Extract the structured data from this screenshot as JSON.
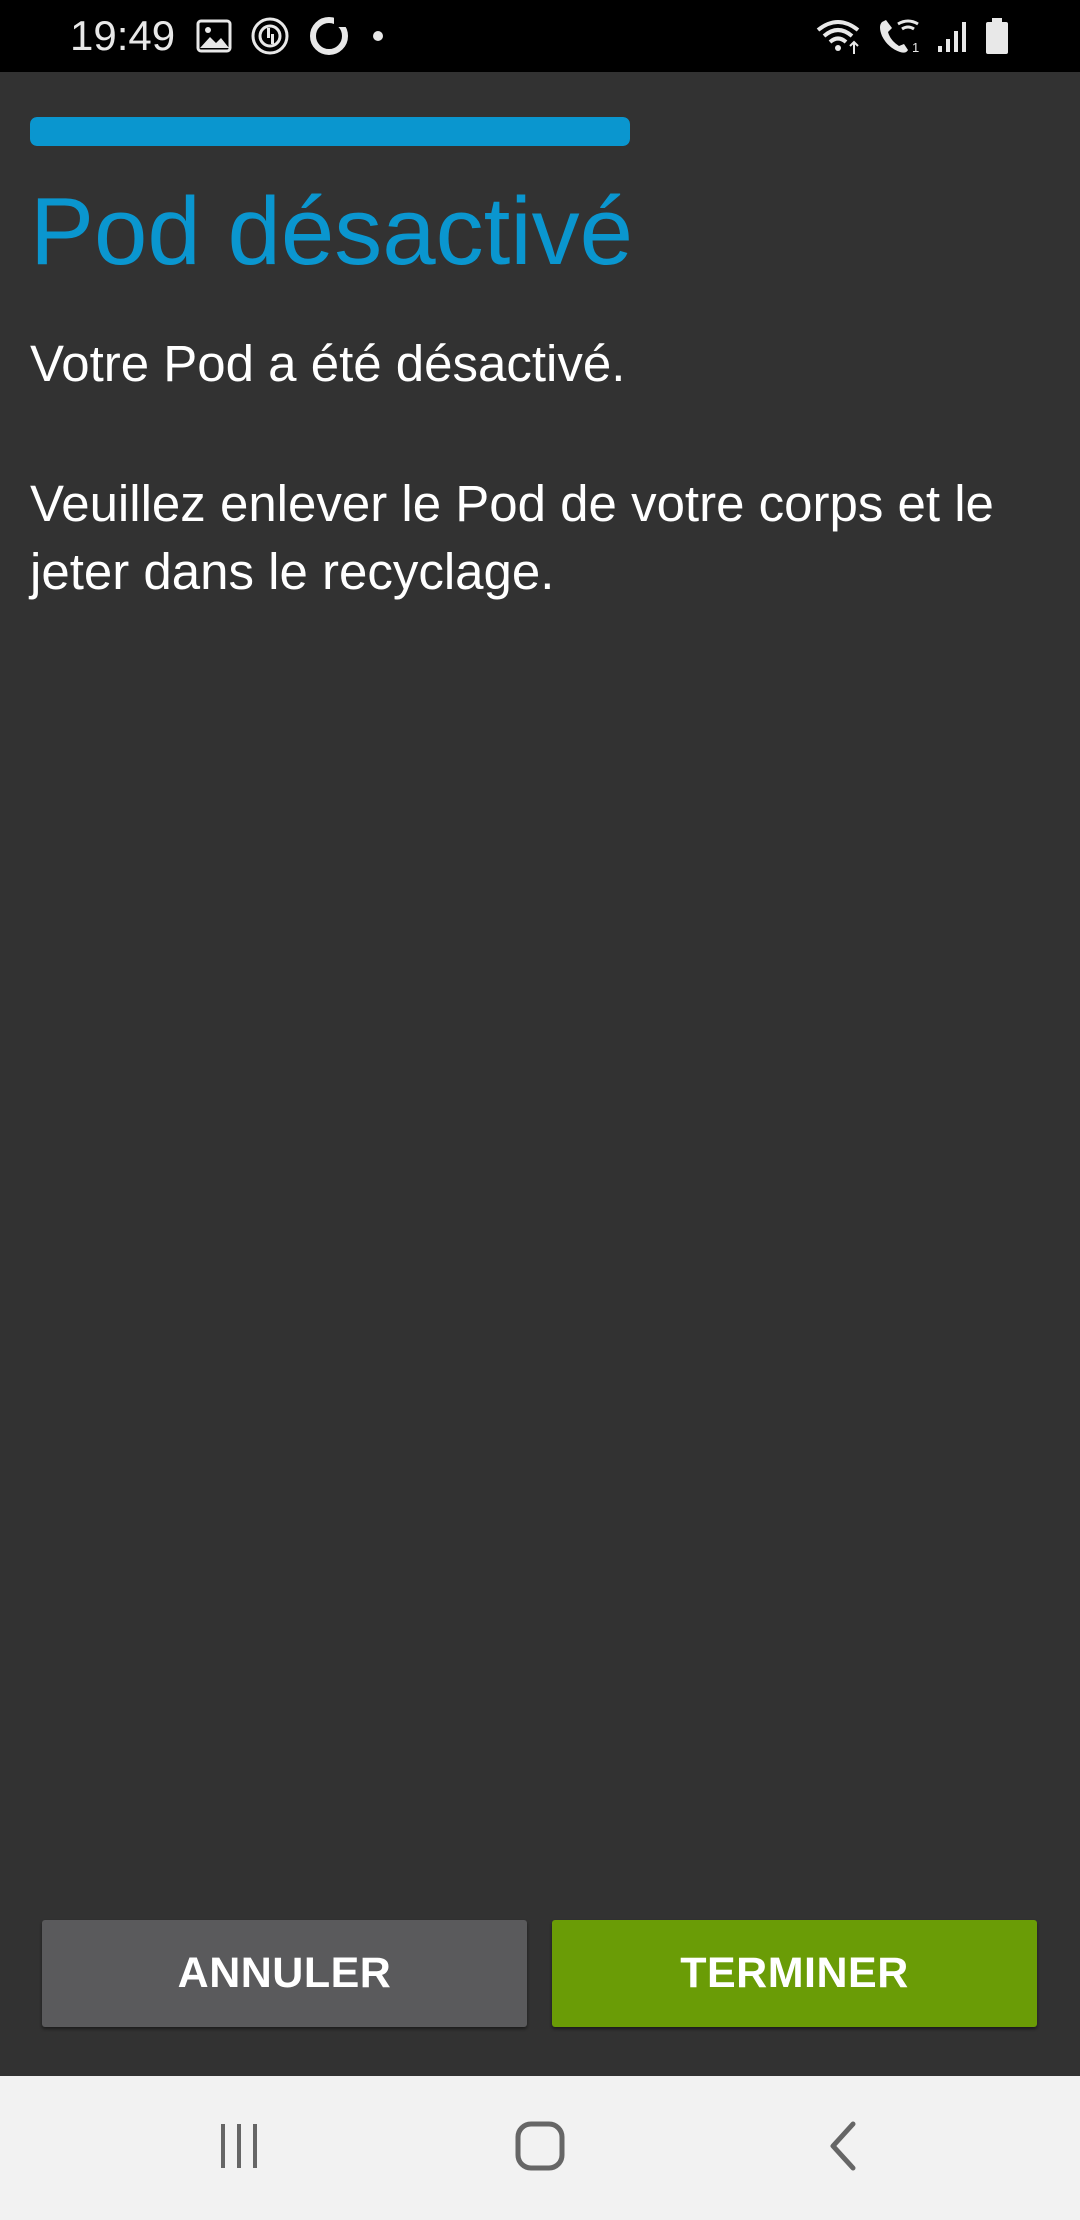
{
  "status_bar": {
    "time": "19:49",
    "left_icons": [
      "image-icon",
      "sync-icon",
      "circle-icon",
      "dot-icon"
    ],
    "right_icons": [
      "wifi-icon",
      "wifi-call-icon",
      "signal-icon",
      "battery-icon"
    ]
  },
  "progress": {
    "value": 1.0,
    "color": "#0a96cf"
  },
  "page": {
    "title": "Pod désactivé",
    "message_1": "Votre Pod a été désactivé.",
    "message_2": "Veuillez enlever le Pod de votre corps et le jeter dans le recyclage."
  },
  "buttons": {
    "cancel_label": "ANNULER",
    "finish_label": "TERMINER",
    "cancel_color": "#5a5a5c",
    "finish_color": "#6a9c06"
  },
  "nav_bar": {
    "icons": [
      "recent-apps-icon",
      "home-icon",
      "back-icon"
    ]
  },
  "colors": {
    "background": "#323232",
    "accent": "#0a96cf"
  }
}
